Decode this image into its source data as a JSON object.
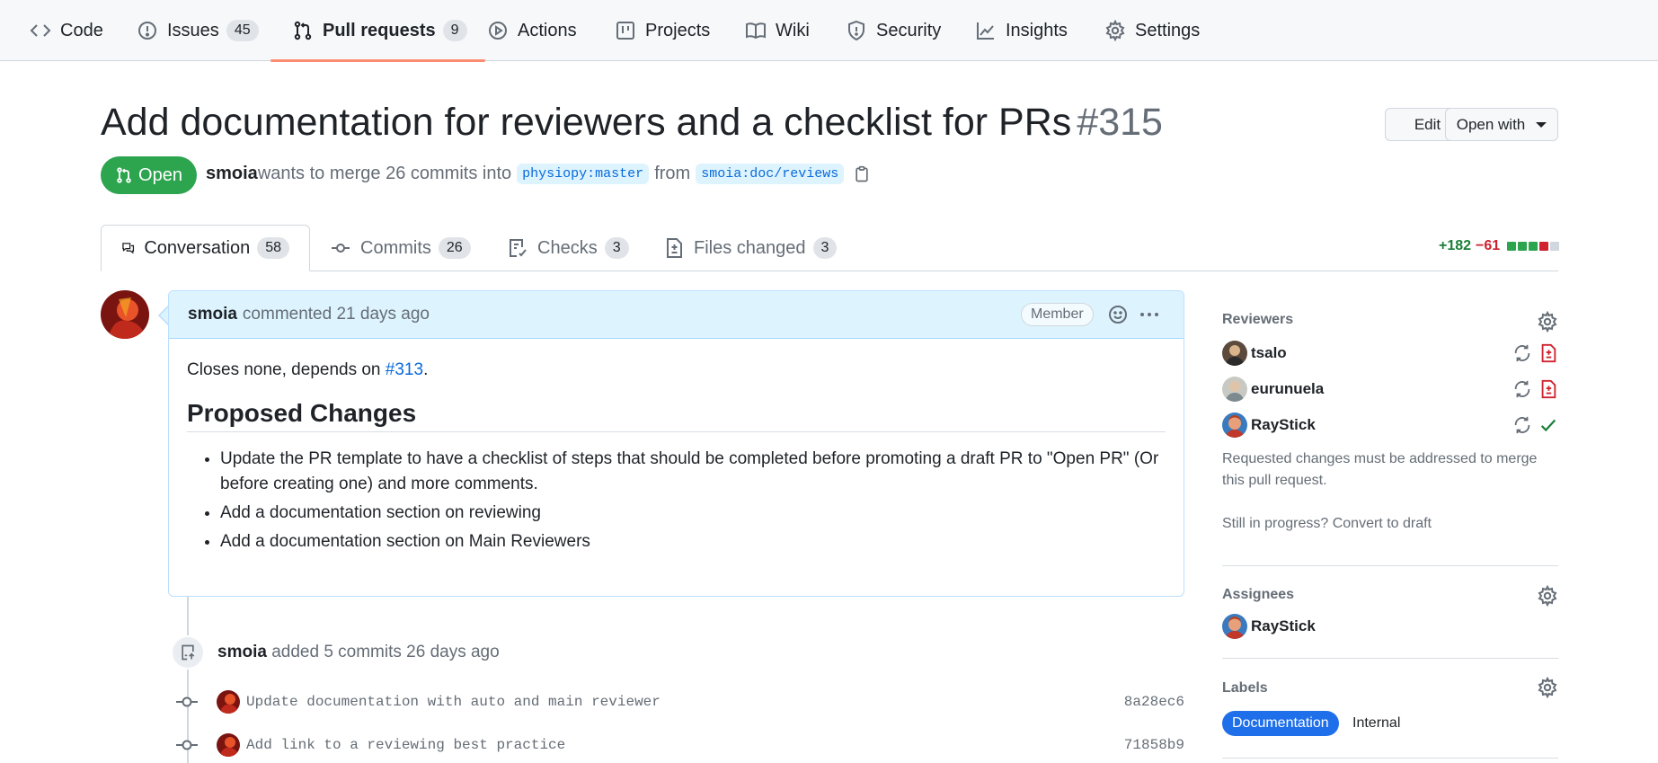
{
  "repo_nav": {
    "items": [
      {
        "label": "Code",
        "icon": "code-icon"
      },
      {
        "label": "Issues",
        "count": "45",
        "icon": "issue-opened-icon"
      },
      {
        "label": "Pull requests",
        "count": "9",
        "icon": "git-pull-request-icon",
        "active": true
      },
      {
        "label": "Actions",
        "icon": "play-icon"
      },
      {
        "label": "Projects",
        "icon": "table-icon"
      },
      {
        "label": "Wiki",
        "icon": "book-icon"
      },
      {
        "label": "Security",
        "icon": "shield-icon"
      },
      {
        "label": "Insights",
        "icon": "graph-icon"
      },
      {
        "label": "Settings",
        "icon": "gear-icon"
      }
    ]
  },
  "pr": {
    "title": "Add documentation for reviewers and a checklist for PRs",
    "number": "#315",
    "edit_label": "Edit",
    "open_with_label": "Open with",
    "state": "Open",
    "author": "smoia",
    "merge_text": "wants to merge 26 commits into",
    "base_branch": "physiopy:master",
    "from_text": "from",
    "head_branch": "smoia:doc/reviews"
  },
  "tabs": [
    {
      "label": "Conversation",
      "count": "58"
    },
    {
      "label": "Commits",
      "count": "26"
    },
    {
      "label": "Checks",
      "count": "3"
    },
    {
      "label": "Files changed",
      "count": "3"
    }
  ],
  "diffstat": {
    "additions": "+182",
    "deletions": "−61"
  },
  "comment": {
    "author": "smoia",
    "action": "commented 21 days ago",
    "badge": "Member",
    "intro_before": "Closes none, depends on ",
    "intro_link": "#313",
    "intro_after": ".",
    "heading": "Proposed Changes",
    "bullets": [
      "Update the PR template to have a checklist of steps that should be completed before promoting a draft PR to \"Open PR\" (Or before creating one) and more comments.",
      "Add a documentation section on reviewing",
      "Add a documentation section on Main Reviewers"
    ]
  },
  "timeline": {
    "author": "smoia",
    "action": "added 5 commits 26 days ago",
    "commits": [
      {
        "message": "Update documentation with auto and main reviewer",
        "sha": "8a28ec6"
      },
      {
        "message": "Add link to a reviewing best practice",
        "sha": "71858b9"
      }
    ]
  },
  "sidebar": {
    "reviewers_title": "Reviewers",
    "reviewers": [
      {
        "name": "tsalo",
        "status": "changes-requested"
      },
      {
        "name": "eurunuela",
        "status": "changes-requested"
      },
      {
        "name": "RayStick",
        "status": "approved"
      }
    ],
    "reviewers_note": "Requested changes must be addressed to merge this pull request.",
    "draft_note": "Still in progress? Convert to draft",
    "assignees_title": "Assignees",
    "assignees": [
      {
        "name": "RayStick"
      }
    ],
    "labels_title": "Labels",
    "labels": [
      {
        "name": "Documentation",
        "color": "#1f6feb"
      },
      {
        "name": "Internal",
        "color": "#ffffff"
      }
    ]
  },
  "colors": {
    "open_green": "#2da44e",
    "link_blue": "#0969da",
    "additions": "#1a7f37",
    "deletions": "#cf222e",
    "active_tab_underline": "#fd8c73"
  }
}
